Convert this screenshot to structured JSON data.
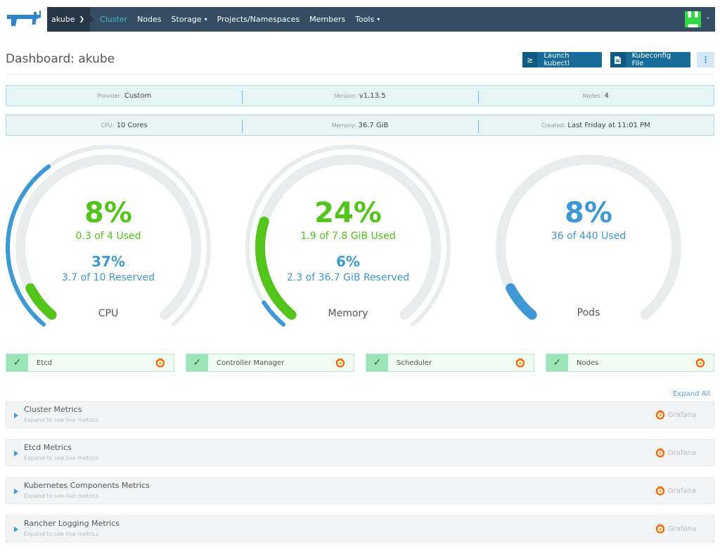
{
  "nav": {
    "cluster_name": "akube",
    "items": [
      {
        "label": "Cluster",
        "active": true,
        "dropdown": false
      },
      {
        "label": "Nodes",
        "active": false,
        "dropdown": false
      },
      {
        "label": "Storage",
        "active": false,
        "dropdown": true
      },
      {
        "label": "Projects/Namespaces",
        "active": false,
        "dropdown": false
      },
      {
        "label": "Members",
        "active": false,
        "dropdown": false
      },
      {
        "label": "Tools",
        "active": false,
        "dropdown": true
      }
    ],
    "chevron": "⌄"
  },
  "header": {
    "title": "Dashboard: akube",
    "launch_kubectl": "Launch kubectl",
    "kubectl_icon": "≥",
    "kubeconfig_file": "Kubeconfig File",
    "kubeconfig_icon": "🗎",
    "more_icon": "⋮"
  },
  "info": {
    "row1": [
      {
        "key": "Provider:",
        "value": "Custom"
      },
      {
        "key": "Version:",
        "value": "v1.13.5"
      },
      {
        "key": "Nodes:",
        "value": "4"
      }
    ],
    "row2": [
      {
        "key": "CPU:",
        "value": "10 Cores"
      },
      {
        "key": "Memory:",
        "value": "36.7 GiB"
      },
      {
        "key": "Created:",
        "value": "Last Friday at 11:01 PM"
      }
    ]
  },
  "gauges": [
    {
      "name": "CPU",
      "used_pct_label": "8%",
      "used_label": "0.3 of 4 Used",
      "used_fraction": 0.08,
      "reserved_pct_label": "37%",
      "reserved_label": "3.7 of 10 Reserved",
      "reserved_fraction": 0.37
    },
    {
      "name": "Memory",
      "used_pct_label": "24%",
      "used_label": "1.9 of 7.8 GiB Used",
      "used_fraction": 0.24,
      "reserved_pct_label": "6%",
      "reserved_label": "2.3 of 36.7 GiB Reserved",
      "reserved_fraction": 0.06
    },
    {
      "name": "Pods",
      "used_pct_label": "8%",
      "used_label": "36 of 440 Used",
      "used_fraction": 0.08
    }
  ],
  "colors": {
    "used": "#52c41a",
    "reserved": "#3d98d3",
    "track": "#e9eced",
    "grafana": "#f46800"
  },
  "components": [
    {
      "name": "Etcd",
      "status": "healthy"
    },
    {
      "name": "Controller Manager",
      "status": "healthy"
    },
    {
      "name": "Scheduler",
      "status": "healthy"
    },
    {
      "name": "Nodes",
      "status": "healthy"
    }
  ],
  "status_icon": "✓",
  "expand_all": "Expand All",
  "metrics": [
    {
      "title": "Cluster Metrics",
      "subtitle": "Expand to see live metrics",
      "link": "Grafana"
    },
    {
      "title": "Etcd Metrics",
      "subtitle": "Expand to see live metrics",
      "link": "Grafana"
    },
    {
      "title": "Kubernetes Components Metrics",
      "subtitle": "Expand to see live metrics",
      "link": "Grafana"
    },
    {
      "title": "Rancher Logging Metrics",
      "subtitle": "Expand to see live metrics",
      "link": "Grafana"
    }
  ]
}
